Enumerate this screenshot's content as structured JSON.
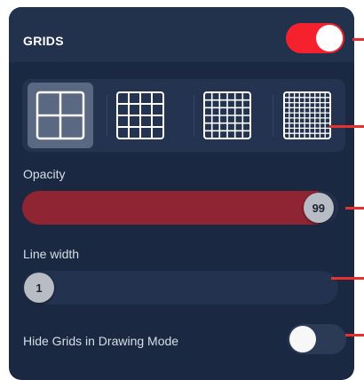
{
  "grids": {
    "title": "GRIDS",
    "enabled": true,
    "options": [
      {
        "name": "grid-2x2-icon",
        "divisions": 2,
        "selected": true
      },
      {
        "name": "grid-4x4-icon",
        "divisions": 4,
        "selected": false
      },
      {
        "name": "grid-6x6-icon",
        "divisions": 6,
        "selected": false
      },
      {
        "name": "grid-9x9-icon",
        "divisions": 9,
        "selected": false
      }
    ]
  },
  "opacity": {
    "label": "Opacity",
    "value": "99",
    "fraction": 0.99
  },
  "line_width": {
    "label": "Line width",
    "value": "1",
    "fraction": 0.0
  },
  "hide_in_drawing": {
    "label": "Hide Grids in Drawing Mode",
    "enabled": false
  },
  "colors": {
    "panel": "#1a2842",
    "accent_red": "#f5222d",
    "opacity_fill": "#8f2433",
    "pointer": "#e8312c"
  }
}
